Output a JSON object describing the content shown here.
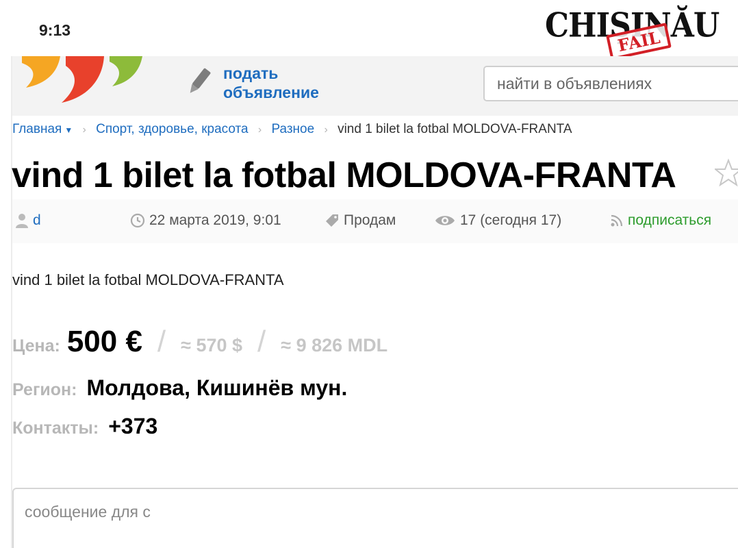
{
  "status_bar": {
    "time": "9:13"
  },
  "watermark": {
    "city": "CHIȘINĂU",
    "stamp": "FAIL"
  },
  "header": {
    "post_ad_line1": "подать",
    "post_ad_line2": "объявление",
    "search_placeholder": "найти в объявлениях",
    "logo_colors": [
      "#f5a623",
      "#e8412c",
      "#8dbb3a"
    ]
  },
  "breadcrumb": {
    "items": [
      "Главная",
      "Спорт, здоровье, красота",
      "Разное"
    ],
    "current": "vind 1 bilet la fotbal MOLDOVA-FRANTA"
  },
  "ad": {
    "title": "vind 1 bilet la fotbal MOLDOVA-FRANTA",
    "description": "vind 1 bilet la fotbal MOLDOVA-FRANTA"
  },
  "meta": {
    "user": "d",
    "date": "22 марта 2019, 9:01",
    "type": "Продам",
    "views": "17 (сегодня 17)",
    "subscribe": "подписаться"
  },
  "details": {
    "price_label": "Цена:",
    "price": "500 €",
    "price_usd": "≈ 570 $",
    "price_mdl": "≈ 9 826 MDL",
    "region_label": "Регион:",
    "region": "Молдова, Кишинёв мун.",
    "contacts_label": "Контакты:",
    "contacts": "+373"
  },
  "message": {
    "placeholder": "сообщение для с"
  }
}
